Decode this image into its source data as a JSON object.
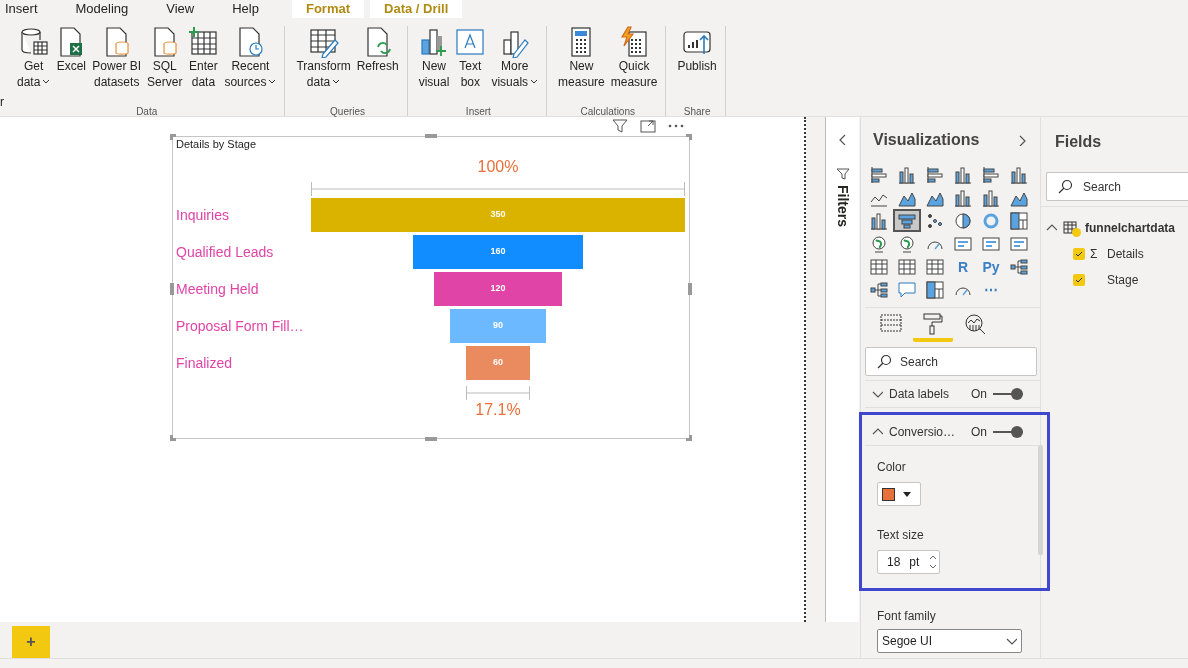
{
  "ribbon": {
    "cut_label": "r",
    "tabs": [
      {
        "label": "Insert",
        "kind": "standard"
      },
      {
        "label": "Modeling",
        "kind": "standard"
      },
      {
        "label": "View",
        "kind": "standard"
      },
      {
        "label": "Help",
        "kind": "standard"
      },
      {
        "label": "Format",
        "kind": "contextual"
      },
      {
        "label": "Data / Drill",
        "kind": "contextual"
      }
    ],
    "groups": [
      {
        "label": "Data",
        "buttons": [
          {
            "lines": [
              "Get",
              "data"
            ],
            "dropdown": true
          },
          {
            "lines": [
              "Excel"
            ],
            "dropdown": false
          },
          {
            "lines": [
              "Power BI",
              "datasets"
            ],
            "dropdown": false
          },
          {
            "lines": [
              "SQL",
              "Server"
            ],
            "dropdown": false
          },
          {
            "lines": [
              "Enter",
              "data"
            ],
            "dropdown": false
          },
          {
            "lines": [
              "Recent",
              "sources"
            ],
            "dropdown": true
          }
        ]
      },
      {
        "label": "Queries",
        "buttons": [
          {
            "lines": [
              "Transform",
              "data"
            ],
            "dropdown": true
          },
          {
            "lines": [
              "Refresh"
            ],
            "dropdown": false
          }
        ]
      },
      {
        "label": "Insert",
        "buttons": [
          {
            "lines": [
              "New",
              "visual"
            ],
            "dropdown": false
          },
          {
            "lines": [
              "Text",
              "box"
            ],
            "dropdown": false
          },
          {
            "lines": [
              "More",
              "visuals"
            ],
            "dropdown": true
          }
        ]
      },
      {
        "label": "Calculations",
        "buttons": [
          {
            "lines": [
              "New",
              "measure"
            ],
            "dropdown": false
          },
          {
            "lines": [
              "Quick",
              "measure"
            ],
            "dropdown": false
          }
        ]
      },
      {
        "label": "Share",
        "buttons": [
          {
            "lines": [
              "Publish"
            ],
            "dropdown": false
          }
        ]
      }
    ]
  },
  "funnel": {
    "title": "Details by Stage",
    "top_label": "100%",
    "bottom_label": "17.1%",
    "stages": [
      {
        "label": "Inquiries",
        "value": "350",
        "color": "#d9b300"
      },
      {
        "label": "Qualified Leads",
        "value": "160",
        "color": "#118dff"
      },
      {
        "label": "Meeting Held",
        "value": "120",
        "color": "#e044a7"
      },
      {
        "label": "Proposal Form Fill…",
        "value": "90",
        "color": "#6cb9ff"
      },
      {
        "label": "Finalized",
        "value": "60",
        "color": "#e98b5f"
      }
    ]
  },
  "filters": {
    "label": "Filters"
  },
  "visualizations": {
    "title": "Visualizations",
    "visuals": [
      {
        "kind": "bars",
        "selected": false
      },
      {
        "kind": "columns",
        "selected": false
      },
      {
        "kind": "bars",
        "selected": false
      },
      {
        "kind": "columns",
        "selected": false
      },
      {
        "kind": "bars",
        "selected": false
      },
      {
        "kind": "columns",
        "selected": false
      },
      {
        "kind": "line",
        "selected": false
      },
      {
        "kind": "area",
        "selected": false
      },
      {
        "kind": "area",
        "selected": false
      },
      {
        "kind": "columns",
        "selected": false
      },
      {
        "kind": "columns",
        "selected": false
      },
      {
        "kind": "area",
        "selected": false
      },
      {
        "kind": "columns",
        "selected": false
      },
      {
        "kind": "funnel",
        "selected": true
      },
      {
        "kind": "scatter",
        "selected": false
      },
      {
        "kind": "pie",
        "selected": false
      },
      {
        "kind": "donut",
        "selected": false
      },
      {
        "kind": "treemap",
        "selected": false
      },
      {
        "kind": "globe",
        "selected": false
      },
      {
        "kind": "globe",
        "selected": false
      },
      {
        "kind": "gauge",
        "selected": false
      },
      {
        "kind": "card",
        "selected": false
      },
      {
        "kind": "card",
        "selected": false
      },
      {
        "kind": "card",
        "selected": false
      },
      {
        "kind": "table",
        "selected": false
      },
      {
        "kind": "table",
        "selected": false
      },
      {
        "kind": "table",
        "selected": false
      },
      {
        "kind": "text",
        "text": "R",
        "selected": false
      },
      {
        "kind": "text",
        "text": "Py",
        "selected": false
      },
      {
        "kind": "tree",
        "selected": false
      },
      {
        "kind": "tree",
        "selected": false
      },
      {
        "kind": "chat",
        "selected": false
      },
      {
        "kind": "treemap",
        "selected": false
      },
      {
        "kind": "gauge",
        "selected": false
      },
      {
        "kind": "text",
        "text": "⋯",
        "selected": false
      }
    ],
    "pane_tabs": [
      {
        "kind": "fields",
        "selected": false
      },
      {
        "kind": "format",
        "selected": true
      },
      {
        "kind": "analytics",
        "selected": false
      }
    ],
    "search": {
      "placeholder": "Search"
    },
    "sections": [
      {
        "label": "Data labels",
        "expanded": false,
        "toggle_label": "On",
        "on": true,
        "highlighted": false
      },
      {
        "label": "Conversio…",
        "expanded": true,
        "toggle_label": "On",
        "on": true,
        "highlighted": true,
        "fields": [
          {
            "kind": "color",
            "label": "Color",
            "color": "#e8703a"
          },
          {
            "kind": "number",
            "label": "Text size",
            "value": "18",
            "unit": "pt"
          }
        ]
      }
    ],
    "font_family": {
      "label": "Font family",
      "value": "Segoe UI"
    }
  },
  "fields": {
    "title": "Fields",
    "search": {
      "placeholder": "Search"
    },
    "tables": [
      {
        "name": "funnelchartdata",
        "expanded": true,
        "checked": true,
        "fields": [
          {
            "name": "Details",
            "checked": true,
            "glyph": "Σ"
          },
          {
            "name": "Stage",
            "checked": true
          }
        ]
      }
    ]
  },
  "pages": {
    "add_label": "+"
  }
}
